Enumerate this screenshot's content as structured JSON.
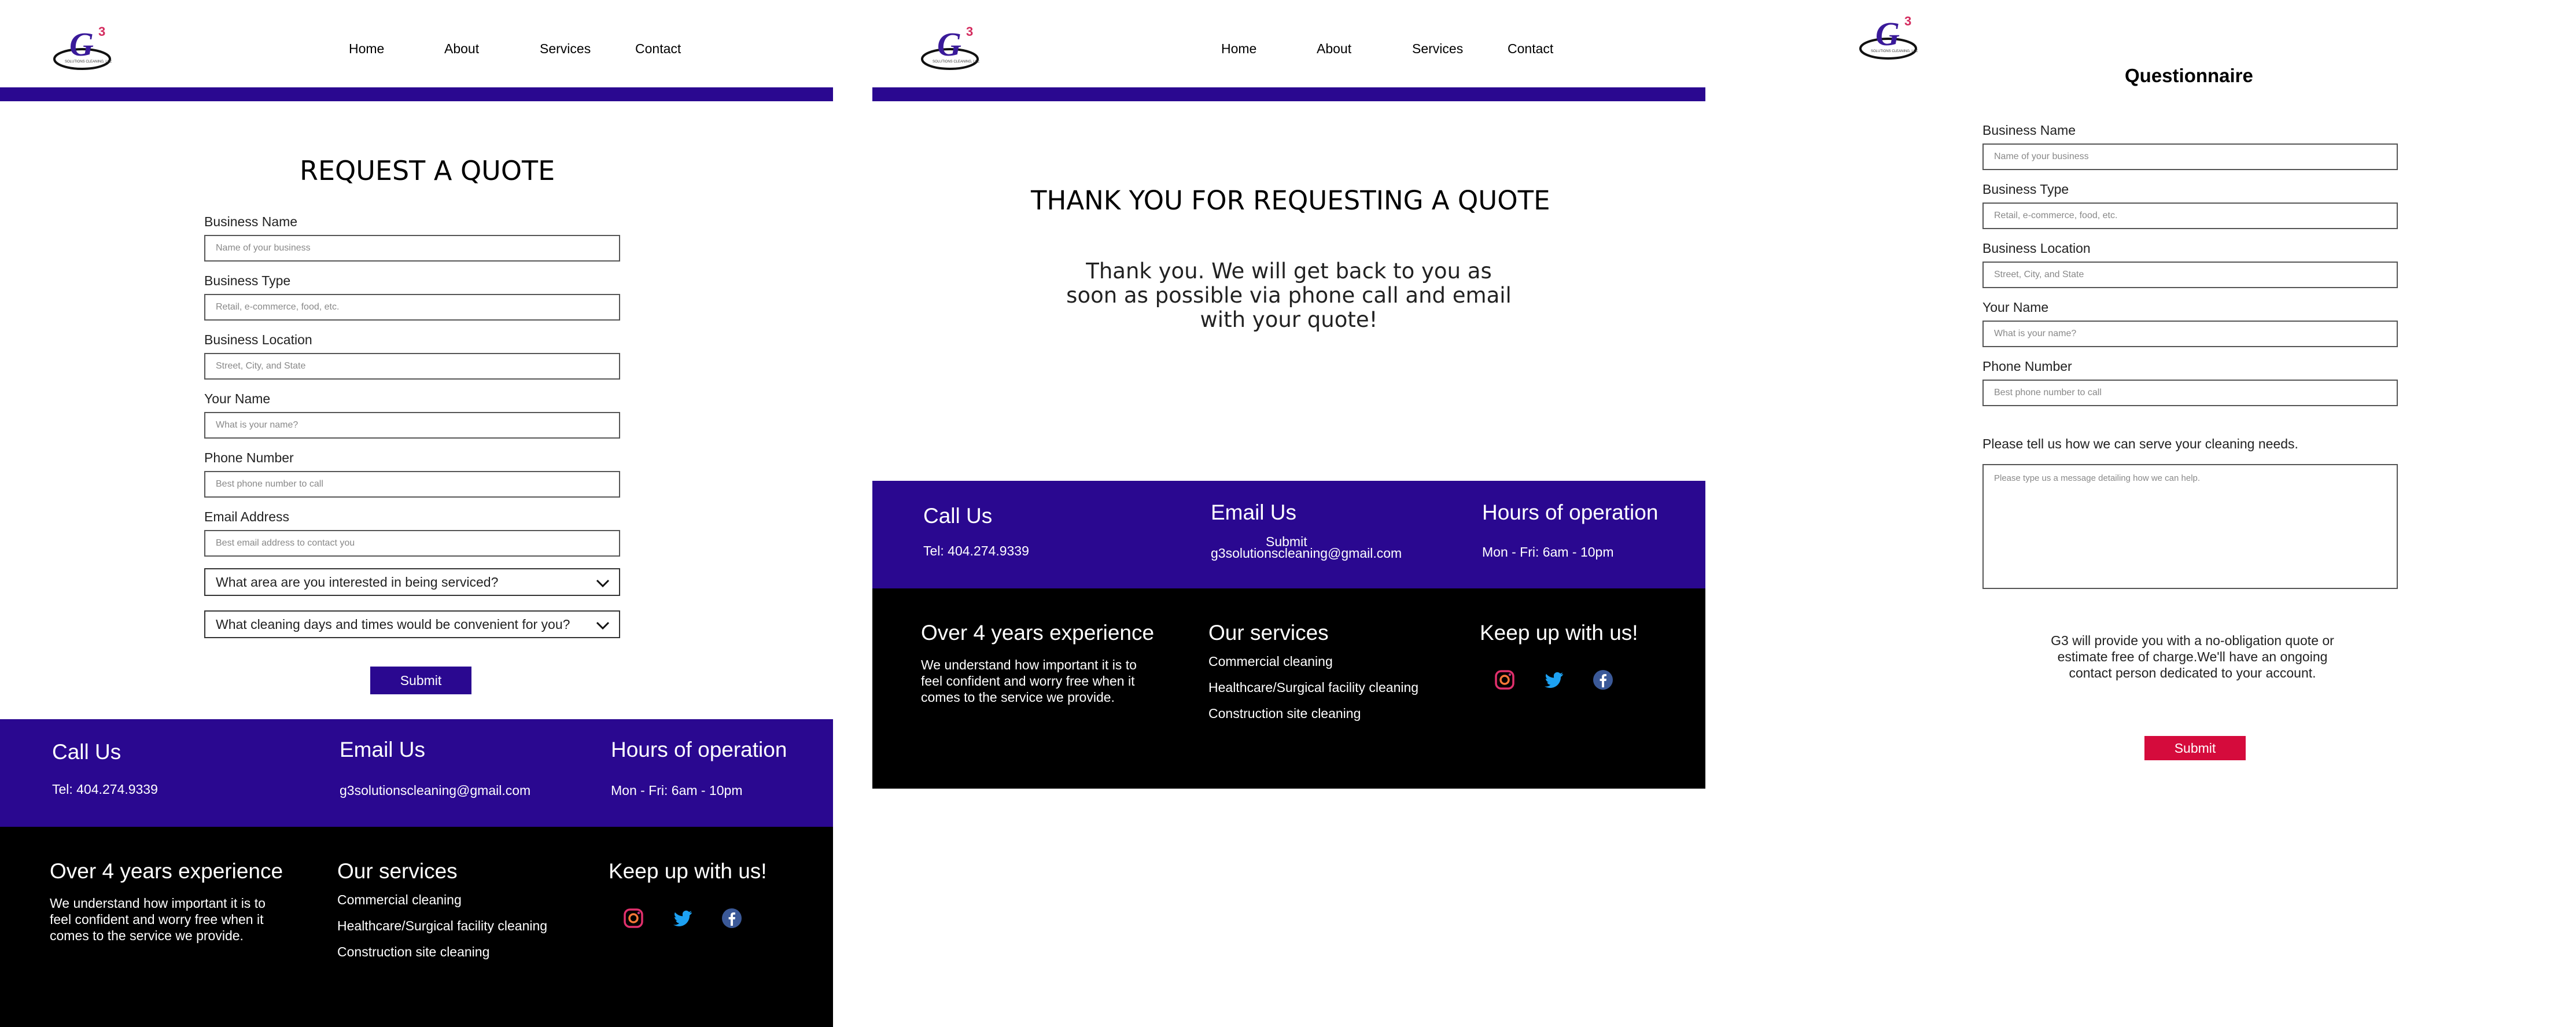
{
  "colors": {
    "brand_purple": "#2a0890",
    "footer_black": "#000000",
    "submit_red": "#d50b3c",
    "logo_purple": "#3a1a9a",
    "logo_red": "#d42b5e"
  },
  "logo": {
    "mark": "G",
    "superscript": "3",
    "tagline": "SOLUTIONS CLEANING, LLC"
  },
  "nav": [
    {
      "label": "Home"
    },
    {
      "label": "About"
    },
    {
      "label": "Services"
    },
    {
      "label": "Contact"
    }
  ],
  "quote_page": {
    "title": "REQUEST A QUOTE",
    "fields": [
      {
        "label": "Business Name",
        "placeholder": "Name of your business"
      },
      {
        "label": "Business Type",
        "placeholder": "Retail, e-commerce, food, etc."
      },
      {
        "label": "Business Location",
        "placeholder": "Street, City, and State"
      },
      {
        "label": "Your Name",
        "placeholder": "What is your name?"
      },
      {
        "label": "Phone Number",
        "placeholder": "Best phone number to call"
      },
      {
        "label": "Email Address",
        "placeholder": "Best email address to contact you"
      }
    ],
    "selects": [
      {
        "value": "What area are you interested in being serviced?",
        "icon": "chevron-down-icon"
      },
      {
        "value": "What cleaning days and times would be convenient for you?",
        "icon": "chevron-down-icon"
      }
    ],
    "submit_label": "Submit"
  },
  "thank_you_page": {
    "title": "THANK YOU FOR REQUESTING A QUOTE",
    "body": "Thank you. We will get back to you as soon as possible via phone call and email with your quote!",
    "stray_label": "Submit"
  },
  "footer": {
    "call": {
      "title": "Call Us",
      "text": "Tel: 404.274.9339"
    },
    "email": {
      "title": "Email Us",
      "text": "g3solutionscleaning@gmail.com"
    },
    "hours": {
      "title": "Hours of operation",
      "text": "Mon - Fri: 6am - 10pm"
    },
    "experience": {
      "title": "Over 4 years experience",
      "text": "We understand how important it is to feel confident and worry free when it comes to the service we provide."
    },
    "services": {
      "title": "Our services",
      "items": [
        "Commercial cleaning",
        "Healthcare/Surgical facility cleaning",
        "Construction site cleaning"
      ]
    },
    "social": {
      "title": "Keep up with us!",
      "icons": [
        "instagram-icon",
        "twitter-icon",
        "facebook-icon"
      ]
    }
  },
  "questionnaire": {
    "title": "Questionnaire",
    "fields": [
      {
        "label": "Business Name",
        "placeholder": "Name of your business"
      },
      {
        "label": "Business Type",
        "placeholder": "Retail, e-commerce, food, etc."
      },
      {
        "label": "Business Location",
        "placeholder": "Street, City, and State"
      },
      {
        "label": "Your Name",
        "placeholder": "What is your name?"
      },
      {
        "label": "Phone Number",
        "placeholder": "Best phone number to call"
      }
    ],
    "message_label": "Please tell us how we can serve your cleaning needs.",
    "message_placeholder": "Please type us a message detailing how we can help.",
    "note": "G3 will provide you with a no-obligation quote or estimate free of charge.We'll have an ongoing contact person dedicated to your account.",
    "submit_label": "Submit"
  }
}
